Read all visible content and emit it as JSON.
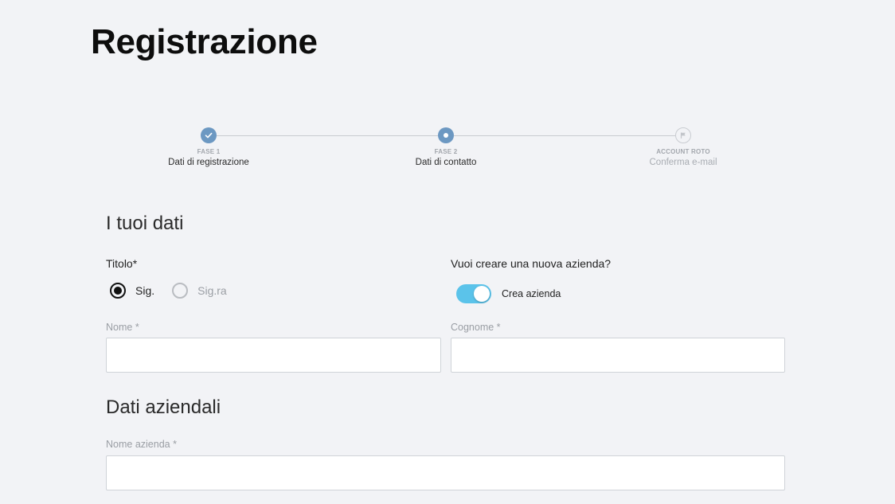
{
  "page": {
    "title": "Registrazione"
  },
  "stepper": {
    "steps": [
      {
        "phase": "FASE 1",
        "label": "Dati di registrazione",
        "state": "done"
      },
      {
        "phase": "FASE 2",
        "label": "Dati di contatto",
        "state": "current"
      },
      {
        "phase": "ACCOUNT ROTO",
        "label": "Conferma e-mail",
        "state": "future"
      }
    ]
  },
  "personal": {
    "section_title": "I tuoi dati",
    "title_label": "Titolo*",
    "title_options": [
      {
        "label": "Sig.",
        "selected": true
      },
      {
        "label": "Sig.ra",
        "selected": false
      }
    ],
    "company_question": "Vuoi creare una nuova azienda?",
    "company_toggle_label": "Crea azienda",
    "company_toggle_on": true,
    "first_name_label": "Nome *",
    "first_name_value": "",
    "last_name_label": "Cognome *",
    "last_name_value": ""
  },
  "company": {
    "section_title": "Dati aziendali",
    "company_name_label": "Nome azienda *",
    "company_name_value": ""
  },
  "colors": {
    "background": "#f2f3f6",
    "step_active": "#6c98c2",
    "toggle_on": "#5bc3ea"
  }
}
